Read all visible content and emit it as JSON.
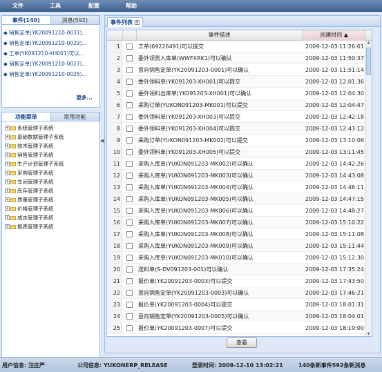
{
  "menu": [
    "文件",
    "工具",
    "配置",
    "帮助"
  ],
  "left_tabs": {
    "events": "事件(140)",
    "messages": "消息(592)"
  },
  "recent_items": [
    "销售定单(YK20091210-0031)...",
    "销售定单(YK20091210-0029)...",
    "工单(YK091210-XH001)可以...",
    "销售定单(YK20091210-0027)...",
    "销售定单(YK20091210-0025)..."
  ],
  "more_label": "更多...",
  "func_tabs": {
    "menu": "功能菜单",
    "common": "常用功能"
  },
  "tree": [
    "系统管理子系统",
    "基础数据管理子系统",
    "技术管理子系统",
    "销售管理子系统",
    "生产计划管理子系统",
    "采购管理子系统",
    "车间管理子系统",
    "库存管理子系统",
    "质量管理子系统",
    "价格管理子系统",
    "成本管理子系统",
    "报表管理子系统"
  ],
  "right_tab": "事件列表",
  "grid": {
    "col_desc": "事件描述",
    "col_time": "创建时间",
    "sort_arrow": "▲",
    "rows": [
      {
        "n": "1",
        "desc": "工单(69226491)可以提交",
        "time": "2009-12-03 11:26:01"
      },
      {
        "n": "2",
        "desc": "委外领货入库单(WWFXRK1)可以确认",
        "time": "2009-12-03 11:50:37"
      },
      {
        "n": "3",
        "desc": "意向销售定单(YK20091203-0001)可以确认",
        "time": "2009-12-03 11:51:14"
      },
      {
        "n": "4",
        "desc": "委外领料单(YK091203-XH001)可以提交",
        "time": "2009-12-03 12:01:36"
      },
      {
        "n": "5",
        "desc": "委外领料出库单(YK091203-XH001)可以确认",
        "time": "2009-12-03 12:04:30"
      },
      {
        "n": "6",
        "desc": "采购订单(YUKON091203-MK001)可以提交",
        "time": "2009-12-03 12:04:47"
      },
      {
        "n": "7",
        "desc": "委外领料单(YK091203-XH003)可以提交",
        "time": "2009-12-03 12:42:18"
      },
      {
        "n": "8",
        "desc": "委外领料单(YK091203-XH004)可以提交",
        "time": "2009-12-03 12:43:12"
      },
      {
        "n": "9",
        "desc": "采购订单(YUKON091203-MK002)可以提交",
        "time": "2009-12-03 13:10:06"
      },
      {
        "n": "10",
        "desc": "委外领料单(YK091203-XH005)可以提交",
        "time": "2009-12-03 13:11:45"
      },
      {
        "n": "11",
        "desc": "采购入库单(YUKON091203-MK002)可以确认",
        "time": "2009-12-03 14:42:26"
      },
      {
        "n": "12",
        "desc": "采购入库单(YUKON091203-MK003)可以确认",
        "time": "2009-12-03 14:43:08"
      },
      {
        "n": "13",
        "desc": "采购入库单(YUKON091203-MK004)可以确认",
        "time": "2009-12-03 14:46:11"
      },
      {
        "n": "14",
        "desc": "采购入库单(YUKON091203-MK005)可以确认",
        "time": "2009-12-03 14:47:15"
      },
      {
        "n": "15",
        "desc": "采购入库单(YUKON091203-MK006)可以确认",
        "time": "2009-12-03 14:48:27"
      },
      {
        "n": "16",
        "desc": "采购入库单(YUKON091203-MK007)可以确认",
        "time": "2009-12-03 15:10:22"
      },
      {
        "n": "17",
        "desc": "采购入库单(YUKON091203-MK008)可以确认",
        "time": "2009-12-03 15:11:08"
      },
      {
        "n": "18",
        "desc": "采购入库单(YUKON091203-MK009)可以确认",
        "time": "2009-12-03 15:11:44"
      },
      {
        "n": "19",
        "desc": "采购入库单(YUKON091203-MK010)可以确认",
        "time": "2009-12-03 15:12:30"
      },
      {
        "n": "20",
        "desc": "送料单(S-DV091203-001)可以确认",
        "time": "2009-12-03 17:35:24"
      },
      {
        "n": "21",
        "desc": "报价单(YK20091203-0003)可以提交",
        "time": "2009-12-03 17:43:50"
      },
      {
        "n": "22",
        "desc": "意向销售定单(YK20091203-0003)可以确认",
        "time": "2009-12-03 17:46:21"
      },
      {
        "n": "23",
        "desc": "报价单(YK20091203-0004)可以提交",
        "time": "2009-12-03 18:01:31"
      },
      {
        "n": "24",
        "desc": "意向销售定单(YK20091203-0005)可以确认",
        "time": "2009-12-03 18:04:01"
      },
      {
        "n": "25",
        "desc": "报价单(YK20091203-0007)可以提交",
        "time": "2009-12-03 18:19:00"
      }
    ]
  },
  "query_button": "查看",
  "status": {
    "user": "用户信息: 汪庄严",
    "company": "公司信息: YUKONERP_RELEASE",
    "login": "登录时间: 2009-12-10 13:02:21",
    "counts": "140条新事件592条新消息"
  }
}
